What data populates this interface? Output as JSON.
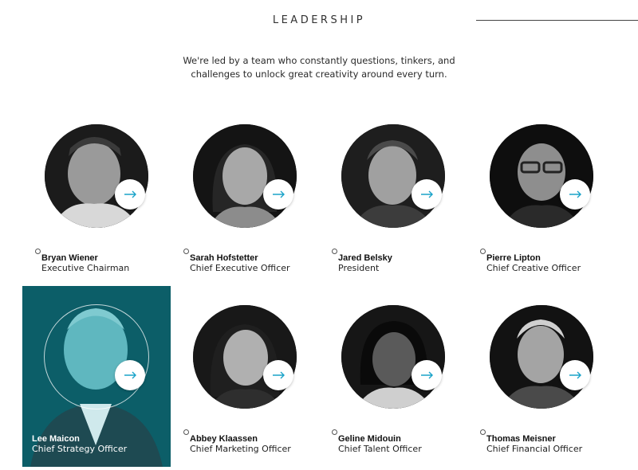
{
  "page": {
    "title": "LEADERSHIP",
    "intro_line1": "We're led by a team who constantly questions, tinkers, and",
    "intro_line2": "challenges to unlock great creativity around every turn."
  },
  "leaders": [
    {
      "name": "Bryan Wiener",
      "role": "Executive Chairman"
    },
    {
      "name": "Sarah Hofstetter",
      "role": "Chief Executive Officer"
    },
    {
      "name": "Jared Belsky",
      "role": "President"
    },
    {
      "name": "Pierre Lipton",
      "role": "Chief Creative Officer"
    },
    {
      "name": "Lee Maicon",
      "role": "Chief Strategy Officer",
      "active": true
    },
    {
      "name": "Abbey Klaassen",
      "role": "Chief Marketing Officer"
    },
    {
      "name": "Geline Midouin",
      "role": "Chief Talent Officer"
    },
    {
      "name": "Thomas Meisner",
      "role": "Chief Financial Officer"
    }
  ],
  "icons": {
    "arrow": "arrow-right-icon",
    "bullet": "circle-bullet-icon"
  },
  "colors": {
    "accent": "#1aa3c9",
    "active_card": "#0c5e68"
  }
}
